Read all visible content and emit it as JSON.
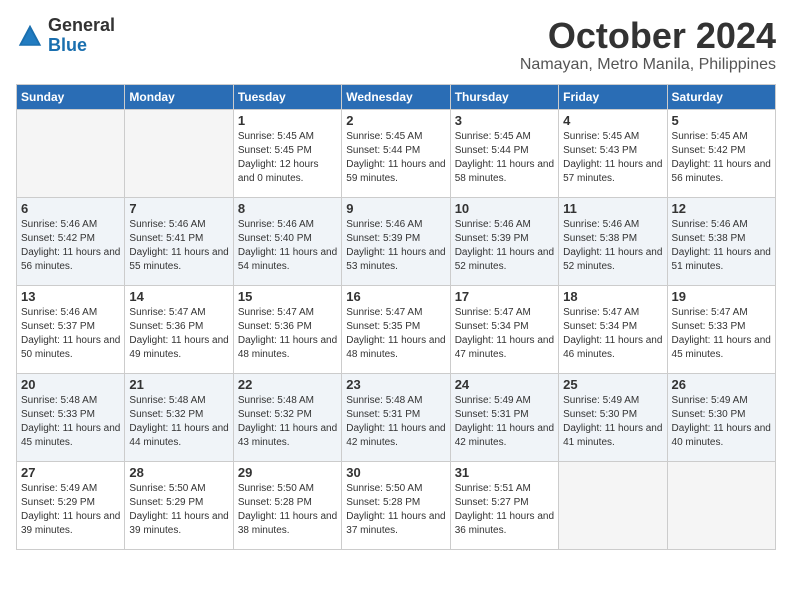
{
  "header": {
    "logo_general": "General",
    "logo_blue": "Blue",
    "month": "October 2024",
    "location": "Namayan, Metro Manila, Philippines"
  },
  "days_of_week": [
    "Sunday",
    "Monday",
    "Tuesday",
    "Wednesday",
    "Thursday",
    "Friday",
    "Saturday"
  ],
  "weeks": [
    [
      {
        "day": "",
        "empty": true
      },
      {
        "day": "",
        "empty": true
      },
      {
        "day": "1",
        "sunrise": "Sunrise: 5:45 AM",
        "sunset": "Sunset: 5:45 PM",
        "daylight": "Daylight: 12 hours and 0 minutes."
      },
      {
        "day": "2",
        "sunrise": "Sunrise: 5:45 AM",
        "sunset": "Sunset: 5:44 PM",
        "daylight": "Daylight: 11 hours and 59 minutes."
      },
      {
        "day": "3",
        "sunrise": "Sunrise: 5:45 AM",
        "sunset": "Sunset: 5:44 PM",
        "daylight": "Daylight: 11 hours and 58 minutes."
      },
      {
        "day": "4",
        "sunrise": "Sunrise: 5:45 AM",
        "sunset": "Sunset: 5:43 PM",
        "daylight": "Daylight: 11 hours and 57 minutes."
      },
      {
        "day": "5",
        "sunrise": "Sunrise: 5:45 AM",
        "sunset": "Sunset: 5:42 PM",
        "daylight": "Daylight: 11 hours and 56 minutes."
      }
    ],
    [
      {
        "day": "6",
        "sunrise": "Sunrise: 5:46 AM",
        "sunset": "Sunset: 5:42 PM",
        "daylight": "Daylight: 11 hours and 56 minutes."
      },
      {
        "day": "7",
        "sunrise": "Sunrise: 5:46 AM",
        "sunset": "Sunset: 5:41 PM",
        "daylight": "Daylight: 11 hours and 55 minutes."
      },
      {
        "day": "8",
        "sunrise": "Sunrise: 5:46 AM",
        "sunset": "Sunset: 5:40 PM",
        "daylight": "Daylight: 11 hours and 54 minutes."
      },
      {
        "day": "9",
        "sunrise": "Sunrise: 5:46 AM",
        "sunset": "Sunset: 5:39 PM",
        "daylight": "Daylight: 11 hours and 53 minutes."
      },
      {
        "day": "10",
        "sunrise": "Sunrise: 5:46 AM",
        "sunset": "Sunset: 5:39 PM",
        "daylight": "Daylight: 11 hours and 52 minutes."
      },
      {
        "day": "11",
        "sunrise": "Sunrise: 5:46 AM",
        "sunset": "Sunset: 5:38 PM",
        "daylight": "Daylight: 11 hours and 52 minutes."
      },
      {
        "day": "12",
        "sunrise": "Sunrise: 5:46 AM",
        "sunset": "Sunset: 5:38 PM",
        "daylight": "Daylight: 11 hours and 51 minutes."
      }
    ],
    [
      {
        "day": "13",
        "sunrise": "Sunrise: 5:46 AM",
        "sunset": "Sunset: 5:37 PM",
        "daylight": "Daylight: 11 hours and 50 minutes."
      },
      {
        "day": "14",
        "sunrise": "Sunrise: 5:47 AM",
        "sunset": "Sunset: 5:36 PM",
        "daylight": "Daylight: 11 hours and 49 minutes."
      },
      {
        "day": "15",
        "sunrise": "Sunrise: 5:47 AM",
        "sunset": "Sunset: 5:36 PM",
        "daylight": "Daylight: 11 hours and 48 minutes."
      },
      {
        "day": "16",
        "sunrise": "Sunrise: 5:47 AM",
        "sunset": "Sunset: 5:35 PM",
        "daylight": "Daylight: 11 hours and 48 minutes."
      },
      {
        "day": "17",
        "sunrise": "Sunrise: 5:47 AM",
        "sunset": "Sunset: 5:34 PM",
        "daylight": "Daylight: 11 hours and 47 minutes."
      },
      {
        "day": "18",
        "sunrise": "Sunrise: 5:47 AM",
        "sunset": "Sunset: 5:34 PM",
        "daylight": "Daylight: 11 hours and 46 minutes."
      },
      {
        "day": "19",
        "sunrise": "Sunrise: 5:47 AM",
        "sunset": "Sunset: 5:33 PM",
        "daylight": "Daylight: 11 hours and 45 minutes."
      }
    ],
    [
      {
        "day": "20",
        "sunrise": "Sunrise: 5:48 AM",
        "sunset": "Sunset: 5:33 PM",
        "daylight": "Daylight: 11 hours and 45 minutes."
      },
      {
        "day": "21",
        "sunrise": "Sunrise: 5:48 AM",
        "sunset": "Sunset: 5:32 PM",
        "daylight": "Daylight: 11 hours and 44 minutes."
      },
      {
        "day": "22",
        "sunrise": "Sunrise: 5:48 AM",
        "sunset": "Sunset: 5:32 PM",
        "daylight": "Daylight: 11 hours and 43 minutes."
      },
      {
        "day": "23",
        "sunrise": "Sunrise: 5:48 AM",
        "sunset": "Sunset: 5:31 PM",
        "daylight": "Daylight: 11 hours and 42 minutes."
      },
      {
        "day": "24",
        "sunrise": "Sunrise: 5:49 AM",
        "sunset": "Sunset: 5:31 PM",
        "daylight": "Daylight: 11 hours and 42 minutes."
      },
      {
        "day": "25",
        "sunrise": "Sunrise: 5:49 AM",
        "sunset": "Sunset: 5:30 PM",
        "daylight": "Daylight: 11 hours and 41 minutes."
      },
      {
        "day": "26",
        "sunrise": "Sunrise: 5:49 AM",
        "sunset": "Sunset: 5:30 PM",
        "daylight": "Daylight: 11 hours and 40 minutes."
      }
    ],
    [
      {
        "day": "27",
        "sunrise": "Sunrise: 5:49 AM",
        "sunset": "Sunset: 5:29 PM",
        "daylight": "Daylight: 11 hours and 39 minutes."
      },
      {
        "day": "28",
        "sunrise": "Sunrise: 5:50 AM",
        "sunset": "Sunset: 5:29 PM",
        "daylight": "Daylight: 11 hours and 39 minutes."
      },
      {
        "day": "29",
        "sunrise": "Sunrise: 5:50 AM",
        "sunset": "Sunset: 5:28 PM",
        "daylight": "Daylight: 11 hours and 38 minutes."
      },
      {
        "day": "30",
        "sunrise": "Sunrise: 5:50 AM",
        "sunset": "Sunset: 5:28 PM",
        "daylight": "Daylight: 11 hours and 37 minutes."
      },
      {
        "day": "31",
        "sunrise": "Sunrise: 5:51 AM",
        "sunset": "Sunset: 5:27 PM",
        "daylight": "Daylight: 11 hours and 36 minutes."
      },
      {
        "day": "",
        "empty": true
      },
      {
        "day": "",
        "empty": true
      }
    ]
  ]
}
